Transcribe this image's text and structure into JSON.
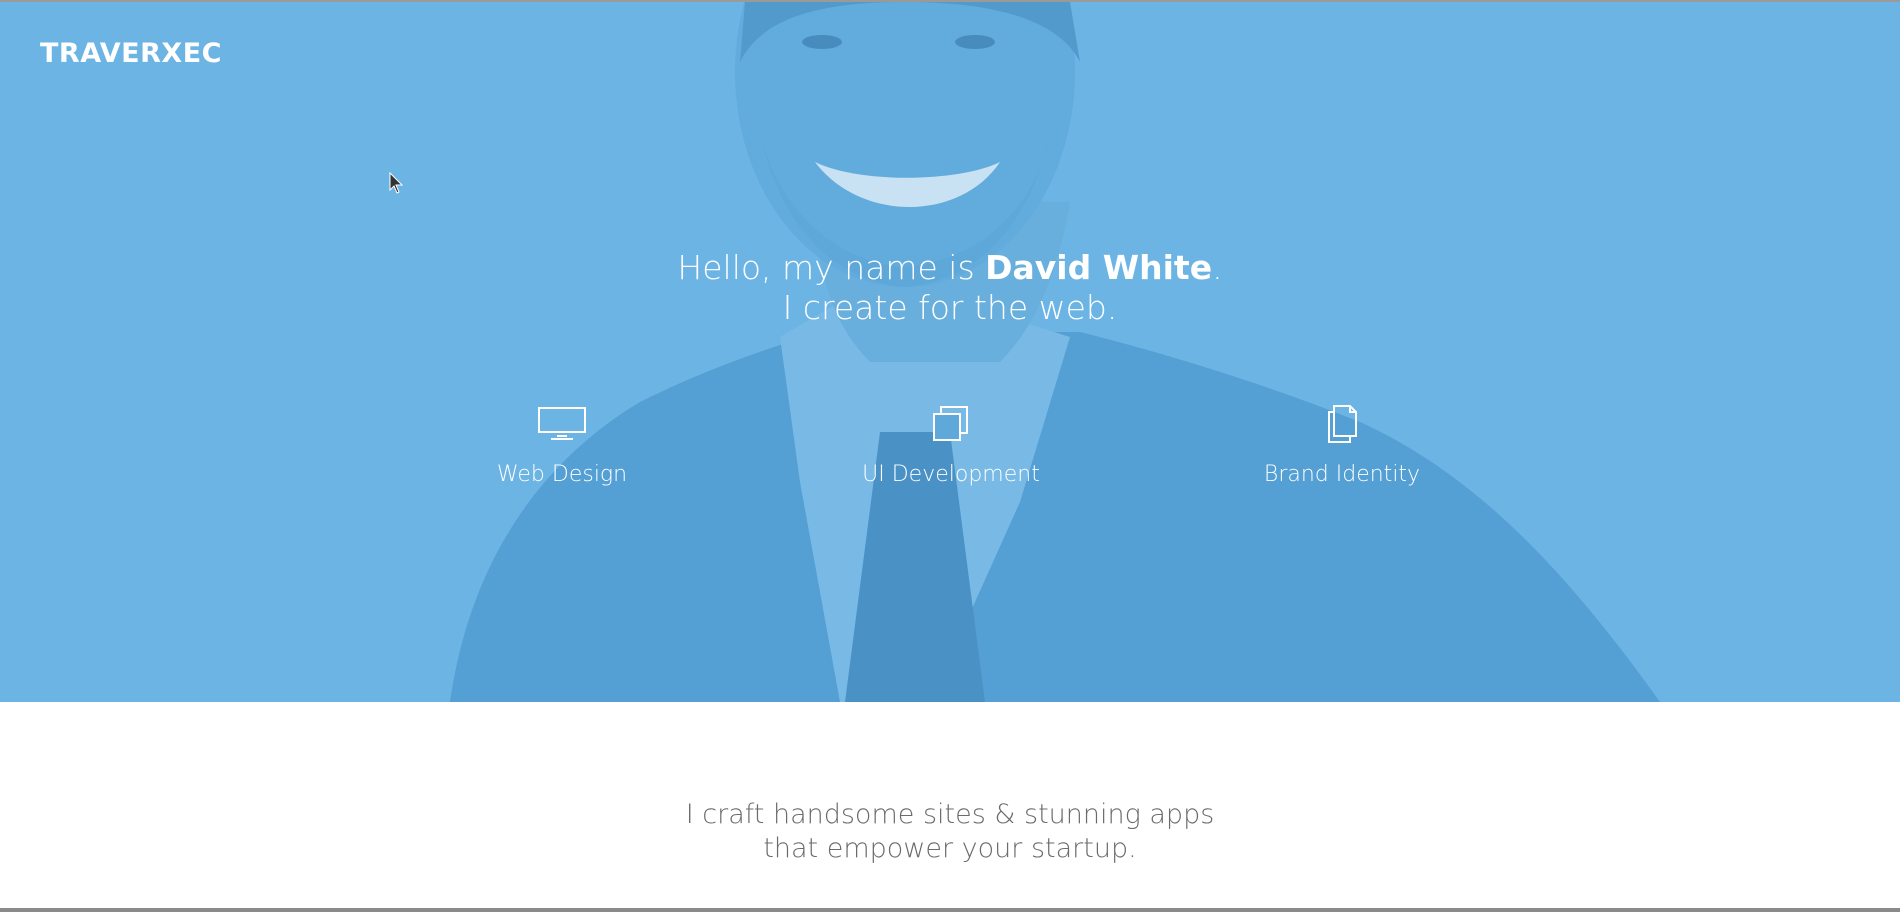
{
  "brand": {
    "logo_text": "TRAVERXEC"
  },
  "hero": {
    "greeting": "Hello, my name is ",
    "name": "David White",
    "greeting_end": ".",
    "subline": "I create for the web.",
    "overlay_color": "#6db4e4"
  },
  "services": [
    {
      "label": "Web Design",
      "icon": "monitor-icon"
    },
    {
      "label": "UI Development",
      "icon": "layers-icon"
    },
    {
      "label": "Brand Identity",
      "icon": "document-icon"
    }
  ],
  "intro": {
    "line1": "I craft handsome sites & stunning apps",
    "line2": "that empower your startup."
  }
}
